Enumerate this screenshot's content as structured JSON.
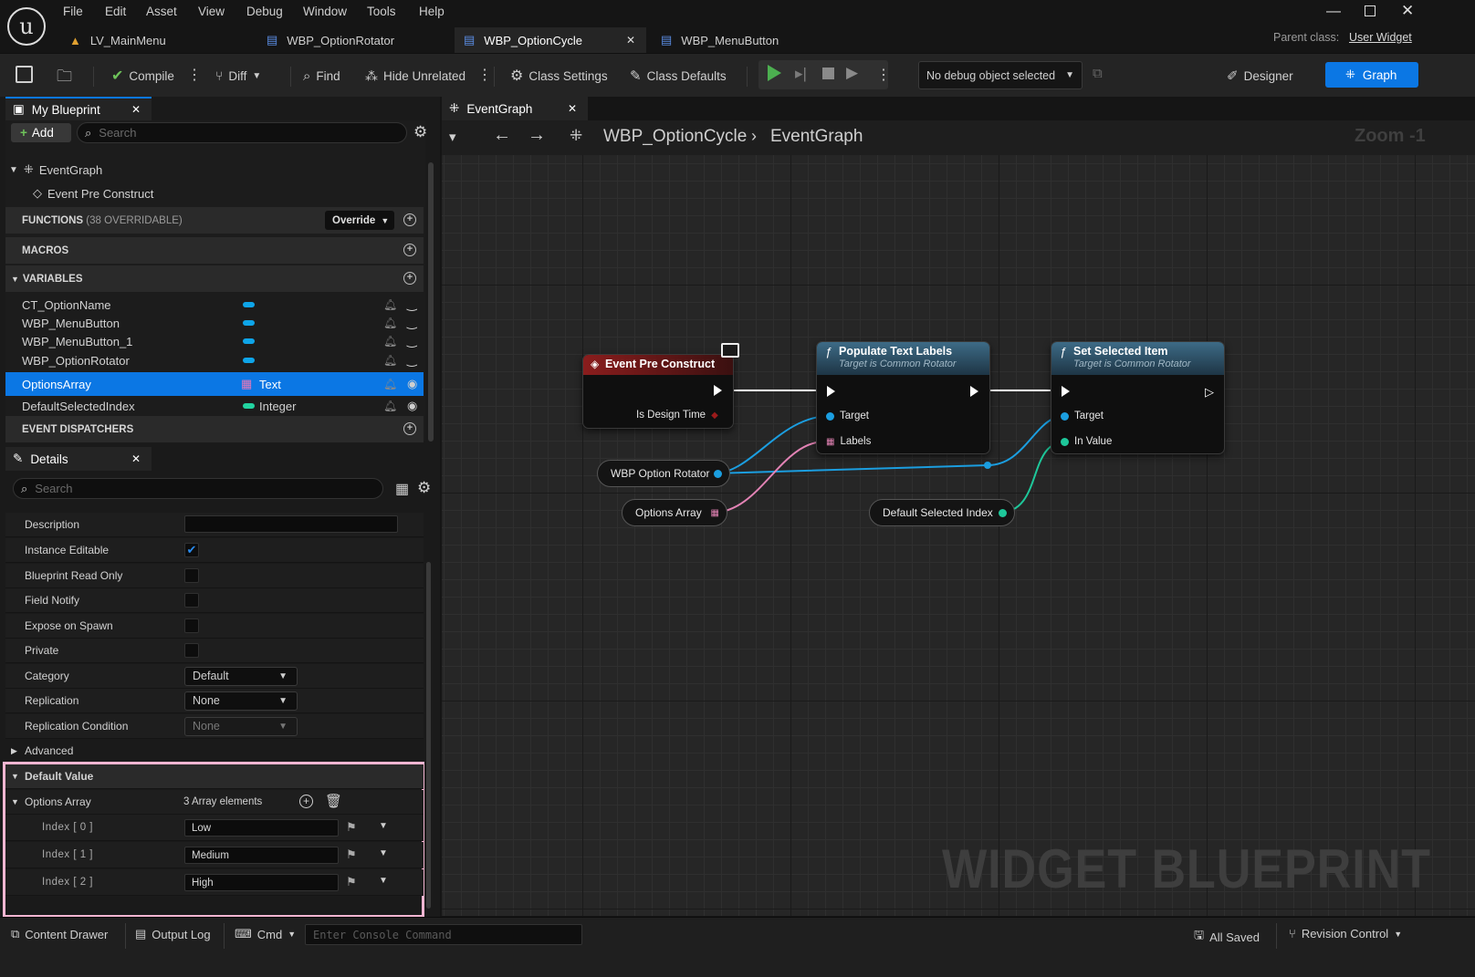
{
  "menu": [
    "File",
    "Edit",
    "Asset",
    "View",
    "Debug",
    "Window",
    "Tools",
    "Help"
  ],
  "tabs": [
    "LV_MainMenu",
    "WBP_OptionRotator",
    "WBP_OptionCycle",
    "WBP_MenuButton"
  ],
  "parent_class": {
    "label": "Parent class:",
    "value": "User Widget"
  },
  "toolbar": {
    "compile": "Compile",
    "diff": "Diff",
    "find": "Find",
    "hide_unrelated": "Hide Unrelated",
    "class_settings": "Class Settings",
    "class_defaults": "Class Defaults",
    "debug_object": "No debug object selected",
    "designer": "Designer",
    "graph": "Graph"
  },
  "my_blueprint": {
    "tab": "My Blueprint",
    "add": "Add",
    "search_placeholder": "Search",
    "event_graph": "EventGraph",
    "event_pre_construct": "Event Pre Construct",
    "functions": "FUNCTIONS",
    "functions_count": "(38 OVERRIDABLE)",
    "override": "Override",
    "macros": "MACROS",
    "variables": "VARIABLES",
    "event_dispatchers": "EVENT DISPATCHERS",
    "vars": [
      {
        "name": "CT_OptionName",
        "type": "",
        "color": "#0ea5e9"
      },
      {
        "name": "WBP_MenuButton",
        "type": "",
        "color": "#0ea5e9"
      },
      {
        "name": "WBP_MenuButton_1",
        "type": "",
        "color": "#0ea5e9"
      },
      {
        "name": "WBP_OptionRotator",
        "type": "",
        "color": "#0ea5e9"
      },
      {
        "name": "OptionsArray",
        "type": "Text",
        "color": "#e879b9"
      },
      {
        "name": "DefaultSelectedIndex",
        "type": "Integer",
        "color": "#22d3a0"
      }
    ]
  },
  "details": {
    "tab": "Details",
    "search_placeholder": "Search",
    "props": [
      "Description",
      "Instance Editable",
      "Blueprint Read Only",
      "Field Notify",
      "Expose on Spawn",
      "Private",
      "Category",
      "Replication",
      "Replication Condition",
      "Advanced"
    ],
    "instance_editable_checked": true,
    "category_value": "Default",
    "replication_value": "None",
    "replication_condition_value": "None",
    "default_value": "Default Value",
    "options_array": "Options Array",
    "array_count": "3 Array elements",
    "elements": [
      {
        "index": "Index [ 0 ]",
        "value": "Low"
      },
      {
        "index": "Index [ 1 ]",
        "value": "Medium"
      },
      {
        "index": "Index [ 2 ]",
        "value": "High"
      }
    ]
  },
  "graph": {
    "tab": "EventGraph",
    "breadcrumb_root": "WBP_OptionCycle",
    "breadcrumb_leaf": "EventGraph",
    "zoom": "Zoom -1",
    "watermark": "WIDGET BLUEPRINT",
    "event_node": {
      "title": "Event Pre Construct",
      "pin": "Is Design Time"
    },
    "populate_node": {
      "title": "Populate Text Labels",
      "subtitle": "Target is Common Rotator",
      "pins": [
        "Target",
        "Labels"
      ]
    },
    "set_node": {
      "title": "Set Selected Item",
      "subtitle": "Target is Common Rotator",
      "pins": [
        "Target",
        "In Value"
      ]
    },
    "var_nodes": [
      "WBP Option Rotator",
      "Options Array",
      "Default Selected Index"
    ]
  },
  "status": {
    "content_drawer": "Content Drawer",
    "output_log": "Output Log",
    "cmd": "Cmd",
    "console_placeholder": "Enter Console Command",
    "all_saved": "All Saved",
    "revision_control": "Revision Control"
  }
}
